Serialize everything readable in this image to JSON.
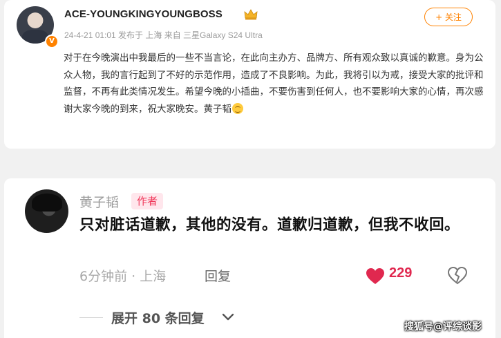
{
  "post": {
    "username": "ACE-YOUNGKINGYOUNGBOSS",
    "meta": "24-4-21 01:01  发布于 上海  来自 三星Galaxy S24 Ultra",
    "follow_label": "+ 关注",
    "text": "对于在今晚演出中我最后的一些不当言论，在此向主办方、品牌方、所有观众致以真诚的歉意。身为公众人物，我的言行起到了不好的示范作用，造成了不良影响。为此，我将引以为戒，接受大家的批评和监督，不再有此类情况发生。希望今晚的小插曲，不要伤害到任何人，也不要影响大家的心情，再次感谢大家今晚的到来，祝大家晚安。黄子韬",
    "badge_icon": "verified-v-icon",
    "crown_icon": "crown-icon",
    "emoji_icon": "smile-emoji-icon"
  },
  "comment": {
    "author": "黄子韬",
    "author_tag": "作者",
    "text": "只对脏话道歉，其他的没有。道歉归道歉，但我不收回。",
    "time_location": "6分钟前 · 上海",
    "reply_label": "回复",
    "like_count": "229",
    "expand_label": "展开 80 条回复",
    "like_icon": "heart-icon",
    "dislike_icon": "broken-heart-icon",
    "expand_icon": "chevron-down-icon"
  },
  "watermark": "搜狐号@评综谈影",
  "colors": {
    "accent_orange": "#ff8200",
    "like_red": "#e0284f",
    "author_tag_bg": "#ffe6ec"
  }
}
